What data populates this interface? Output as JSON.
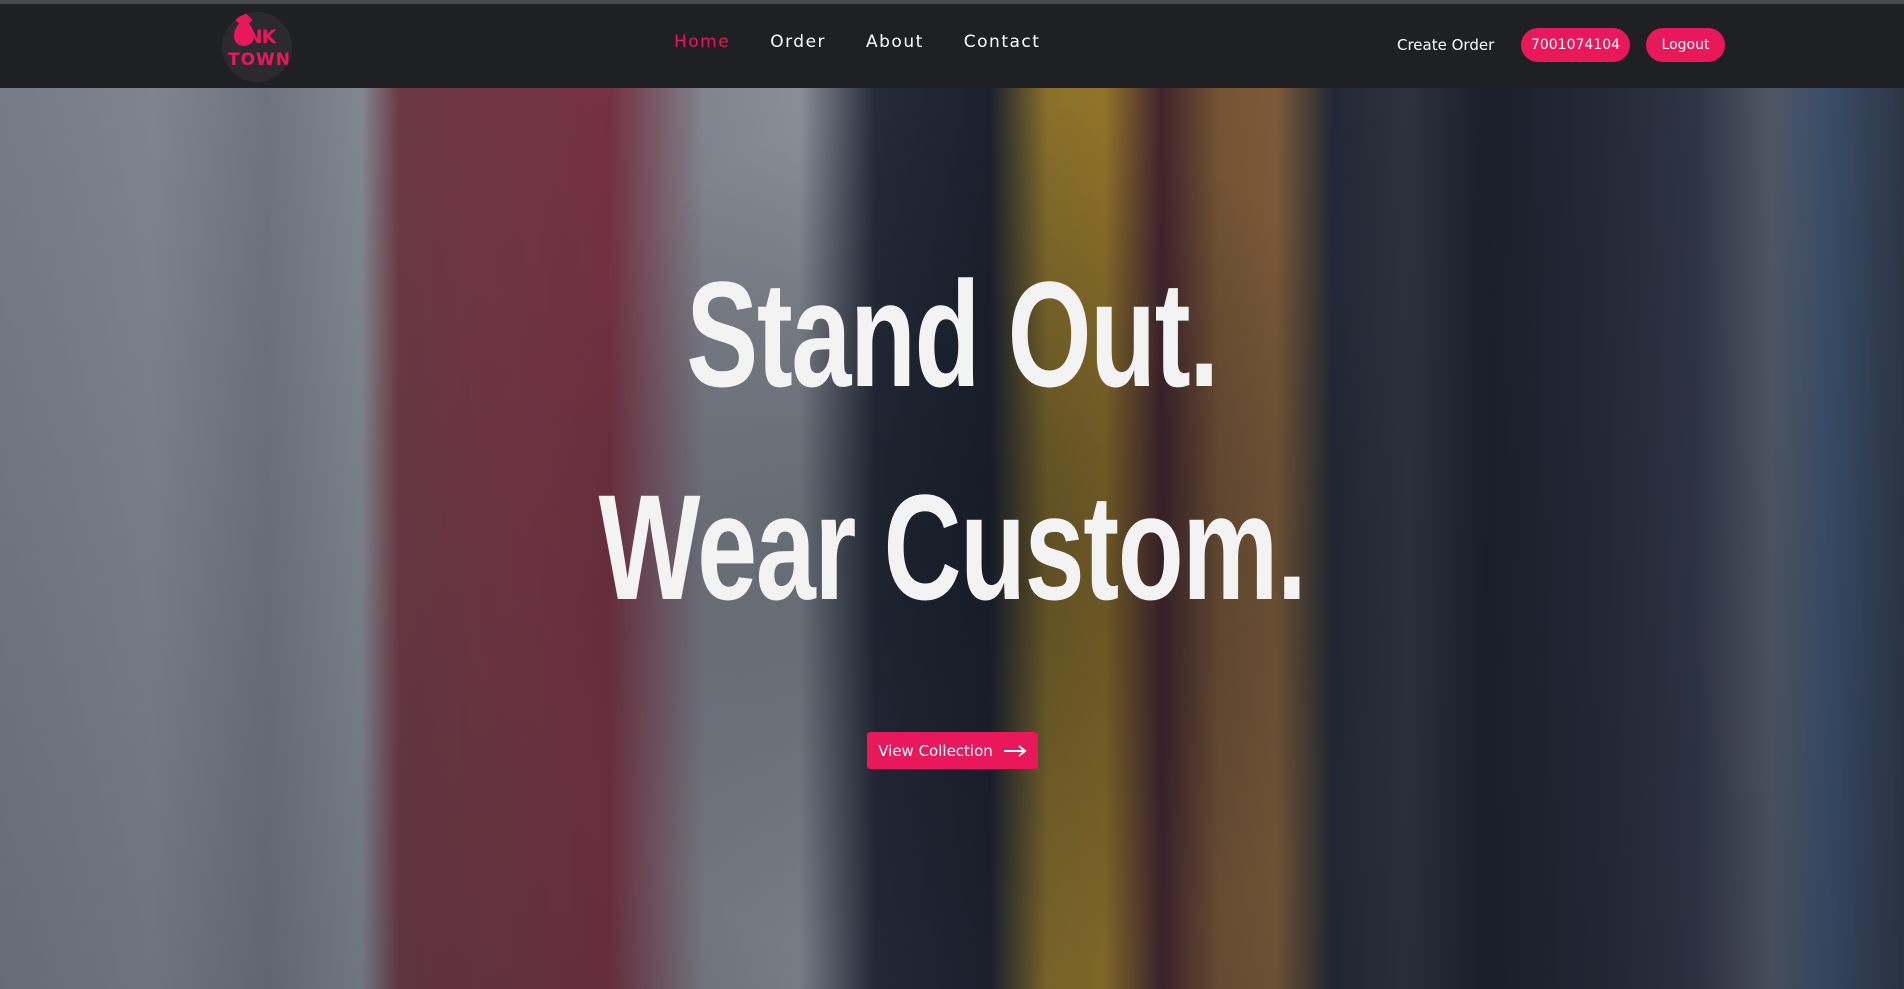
{
  "brand": {
    "logo_top": "INK",
    "logo_bottom": "TOWN",
    "accent_color": "#e8185a"
  },
  "nav": {
    "links": [
      {
        "label": "Home",
        "active": true
      },
      {
        "label": "Order",
        "active": false
      },
      {
        "label": "About",
        "active": false
      },
      {
        "label": "Contact",
        "active": false
      }
    ],
    "create_order_label": "Create Order",
    "phone_label": "7001074104",
    "logout_label": "Logout"
  },
  "hero": {
    "line1": "Stand Out.",
    "line2": "Wear Custom.",
    "cta_label": "View Collection",
    "cta_icon": "arrow-right-icon"
  }
}
